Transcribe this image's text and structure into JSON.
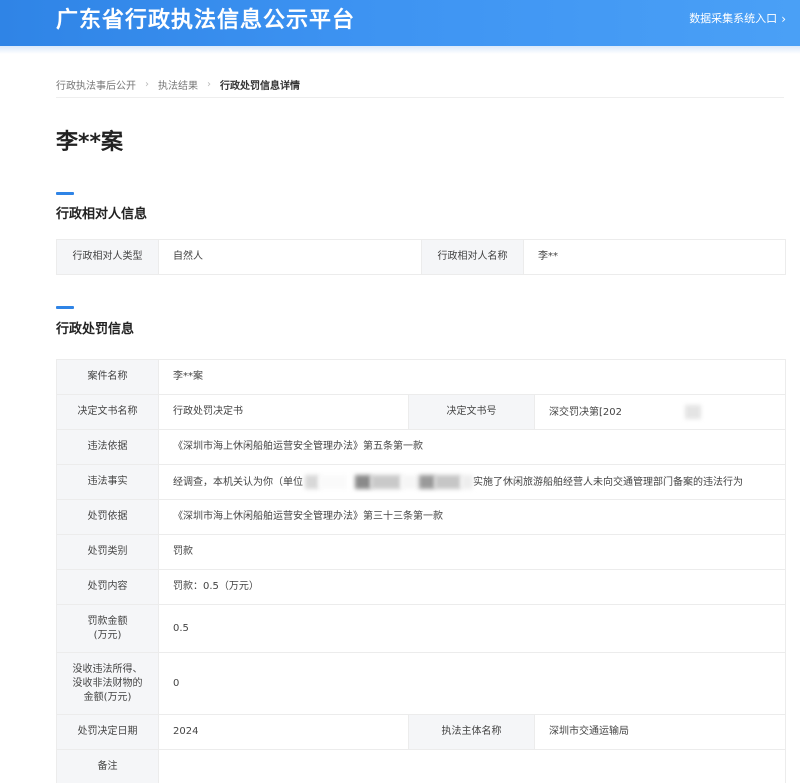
{
  "header": {
    "site_title": "广东省行政执法信息公示平台",
    "entry_link": "数据采集系统入口"
  },
  "breadcrumb": {
    "items": [
      "行政执法事后公开",
      "执法结果",
      "行政处罚信息详情"
    ]
  },
  "case_title": "李**案",
  "party_section": {
    "title": "行政相对人信息",
    "type_label": "行政相对人类型",
    "type_value": "自然人",
    "name_label": "行政相对人名称",
    "name_value": "李**"
  },
  "penalty_section": {
    "title": "行政处罚信息",
    "case_name_label": "案件名称",
    "case_name_value": "李**案",
    "doc_name_label": "决定文书名称",
    "doc_name_value": "行政处罚决定书",
    "doc_no_label": "决定文书号",
    "doc_no_value": "深交罚决第[202",
    "basis_label": "违法依据",
    "basis_value": "《深圳市海上休闲船舶运营安全管理办法》第五条第一款",
    "facts_label": "违法事实",
    "facts_value_start": "经调查，本机关认为你（单位",
    "facts_value_end": "实施了休闲旅游船舶经营人未向交通管理部门备案的违法行为",
    "penalty_basis_label": "处罚依据",
    "penalty_basis_value": "《深圳市海上休闲船舶运营安全管理办法》第三十三条第一款",
    "category_label": "处罚类别",
    "category_value": "罚款",
    "content_label": "处罚内容",
    "content_value": "罚款：0.5（万元）",
    "fine_label_1": "罚款金额",
    "fine_label_2": "(万元)",
    "fine_value": "0.5",
    "confiscate_label_1": "没收违法所得、",
    "confiscate_label_2": "没收非法财物的",
    "confiscate_label_3": "金额(万元)",
    "confiscate_value": "0",
    "date_label": "处罚决定日期",
    "date_value": "2024",
    "authority_label": "执法主体名称",
    "authority_value": "深圳市交通运输局",
    "remark_label": "备注",
    "remark_value": ""
  },
  "colors": {
    "header_blue": "#2f84e6",
    "label_bg": "#f5f6f8"
  }
}
